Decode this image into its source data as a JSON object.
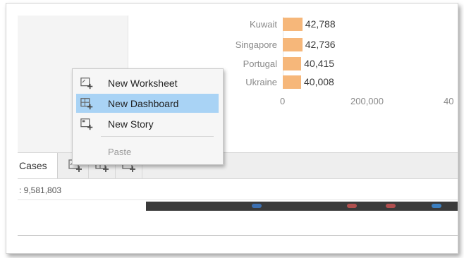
{
  "chart_data": {
    "type": "bar",
    "categories": [
      "Kuwait",
      "Singapore",
      "Portugal",
      "Ukraine"
    ],
    "values": [
      42788,
      42736,
      40415,
      40008
    ],
    "value_labels": [
      "42,788",
      "42,736",
      "40,415",
      "40,008"
    ],
    "x_ticks": [
      "0",
      "200,000",
      "40"
    ],
    "bar_color": "#f6b77a"
  },
  "tabs": {
    "sheet_name": "Cases",
    "new_worksheet_icon": "new-worksheet-icon",
    "new_dashboard_icon": "new-dashboard-icon",
    "new_story_icon": "new-story-icon"
  },
  "status": {
    "text": ": 9,581,803"
  },
  "context_menu": {
    "items": [
      {
        "label": "New Worksheet",
        "icon": "new-worksheet-icon"
      },
      {
        "label": "New Dashboard",
        "icon": "new-dashboard-icon",
        "selected": true
      },
      {
        "label": "New Story",
        "icon": "new-story-icon"
      },
      {
        "label": "Paste",
        "disabled": true
      }
    ],
    "highlight_color": "#a9d3f5"
  }
}
